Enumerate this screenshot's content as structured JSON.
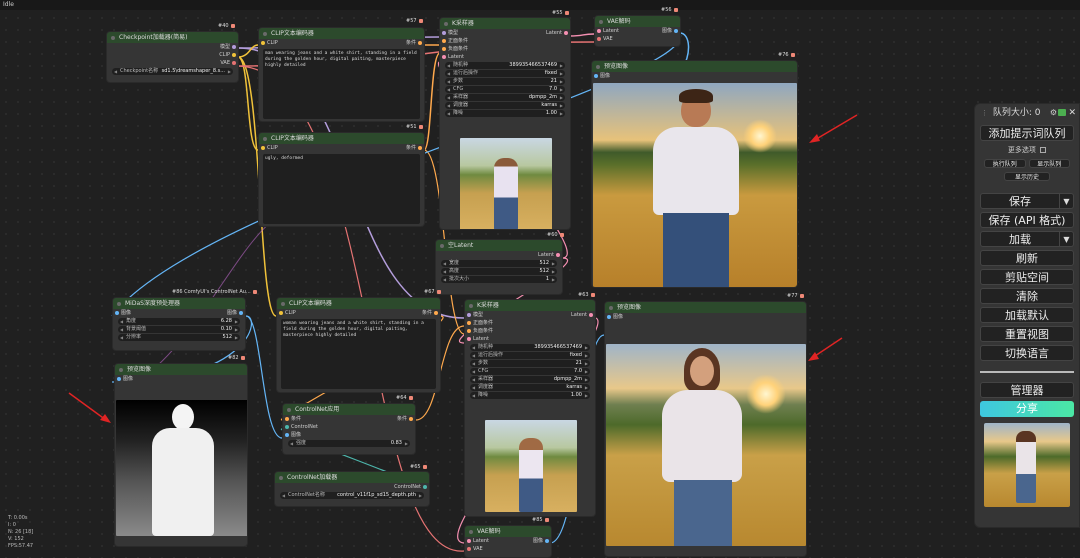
{
  "app": {
    "status": "Idle"
  },
  "stats": [
    "T: 0.00s",
    "I: 0",
    "N: 26 [18]",
    "V: 152",
    "FPS:57.47"
  ],
  "colors": {
    "node_bg": "#353535",
    "node_header": "#2c4a2c",
    "canvas": "#202020",
    "share_gradient_start": "#3ec7e0",
    "share_gradient_end": "#4be7a4"
  },
  "nodes": {
    "checkpoint": {
      "id": "#40",
      "title": "Checkpoint加载器(简易)",
      "outputs": [
        "模型",
        "CLIP",
        "VAE"
      ],
      "widget": {
        "label": "Checkpoint名称",
        "value": "sd1.5\\dreamshaper_8.s..."
      }
    },
    "clip1": {
      "id": "#57",
      "title": "CLIP文本编码器",
      "input": "CLIP",
      "output": "条件",
      "text": "man wearing jeans and a white shirt, standing in a field during the golden hour, digital paiting, masterpiece highly detailed"
    },
    "clip2": {
      "id": "#51",
      "title": "CLIP文本编码器",
      "input": "CLIP",
      "output": "条件",
      "text": "ugly, deformed"
    },
    "ksampler1": {
      "id": "#55",
      "title": "K采样器",
      "inputs": [
        "模型",
        "正面条件",
        "负面条件",
        "Latent"
      ],
      "output": "Latent",
      "widgets": [
        {
          "label": "随机种",
          "value": "389935466537469"
        },
        {
          "label": "运行后操作",
          "value": "fixed"
        },
        {
          "label": "步数",
          "value": "21"
        },
        {
          "label": "CFG",
          "value": "7.0"
        },
        {
          "label": "采样器",
          "value": "dpmpp_2m"
        },
        {
          "label": "调度器",
          "value": "karras"
        },
        {
          "label": "降噪",
          "value": "1.00"
        }
      ]
    },
    "vae1": {
      "id": "#56",
      "title": "VAE解码",
      "inputs": [
        "Latent",
        "VAE"
      ],
      "output": "图像"
    },
    "preview1": {
      "id": "#76",
      "title": "预览图像",
      "input": "图像"
    },
    "empty_latent": {
      "id": "#60",
      "title": "空Latent",
      "output": "Latent",
      "widgets": [
        {
          "label": "宽度",
          "value": "512"
        },
        {
          "label": "高度",
          "value": "512"
        },
        {
          "label": "批次大小",
          "value": "1"
        }
      ]
    },
    "midas": {
      "id": "#86 ComfyUI's ControlNet Au...",
      "title": "MiDaS深度预处理器",
      "input": "图像",
      "output": "图像",
      "widgets": [
        {
          "label": "角度",
          "value": "6.28"
        },
        {
          "label": "背景阈值",
          "value": "0.10"
        },
        {
          "label": "分辨率",
          "value": "512"
        }
      ]
    },
    "preview_depth": {
      "id": "#82",
      "title": "预览图像",
      "input": "图像"
    },
    "clip3": {
      "id": "#67",
      "title": "CLIP文本编码器",
      "input": "CLIP",
      "output": "条件",
      "text": "woman wearing jeans and a white shirt, standing in a field during the golden hour, digital paiting, masterpiece highly detailed"
    },
    "ksampler2": {
      "id": "#63",
      "title": "K采样器",
      "inputs": [
        "模型",
        "正面条件",
        "负面条件",
        "Latent"
      ],
      "output": "Latent",
      "widgets": [
        {
          "label": "随机种",
          "value": "389935466537469"
        },
        {
          "label": "运行后操作",
          "value": "fixed"
        },
        {
          "label": "步数",
          "value": "21"
        },
        {
          "label": "CFG",
          "value": "7.0"
        },
        {
          "label": "采样器",
          "value": "dpmpp_2m"
        },
        {
          "label": "调度器",
          "value": "karras"
        },
        {
          "label": "降噪",
          "value": "1.00"
        }
      ]
    },
    "preview2": {
      "id": "#77",
      "title": "预览图像",
      "input": "图像"
    },
    "controlnet_apply": {
      "id": "#64",
      "title": "ControlNet应用",
      "inputs": [
        "条件",
        "ControlNet",
        "图像"
      ],
      "output": "条件",
      "widget": {
        "label": "强度",
        "value": "0.83"
      }
    },
    "controlnet_loader": {
      "id": "#65",
      "title": "ControlNet加载器",
      "output": "ControlNet",
      "widget": {
        "label": "ControlNet名称",
        "value": "control_v11f1p_sd15_depth.pth"
      }
    },
    "vae2": {
      "id": "#85",
      "title": "VAE解码",
      "inputs": [
        "Latent",
        "VAE"
      ],
      "output": "图像"
    }
  },
  "panel": {
    "queue_label": "队列大小: 0",
    "add_queue": "添加提示词队列",
    "more_options": "更多选项",
    "run_queue": "执行队列",
    "show_queue": "显示队列",
    "show_history": "显示历史",
    "save": "保存",
    "save_api": "保存 (API 格式)",
    "load": "加载",
    "refresh": "刷新",
    "clipspace": "剪贴空间",
    "clear": "清除",
    "load_default": "加载默认",
    "reset_view": "重置视图",
    "switch_lang": "切换语言",
    "manager": "管理器",
    "share": "分享"
  }
}
